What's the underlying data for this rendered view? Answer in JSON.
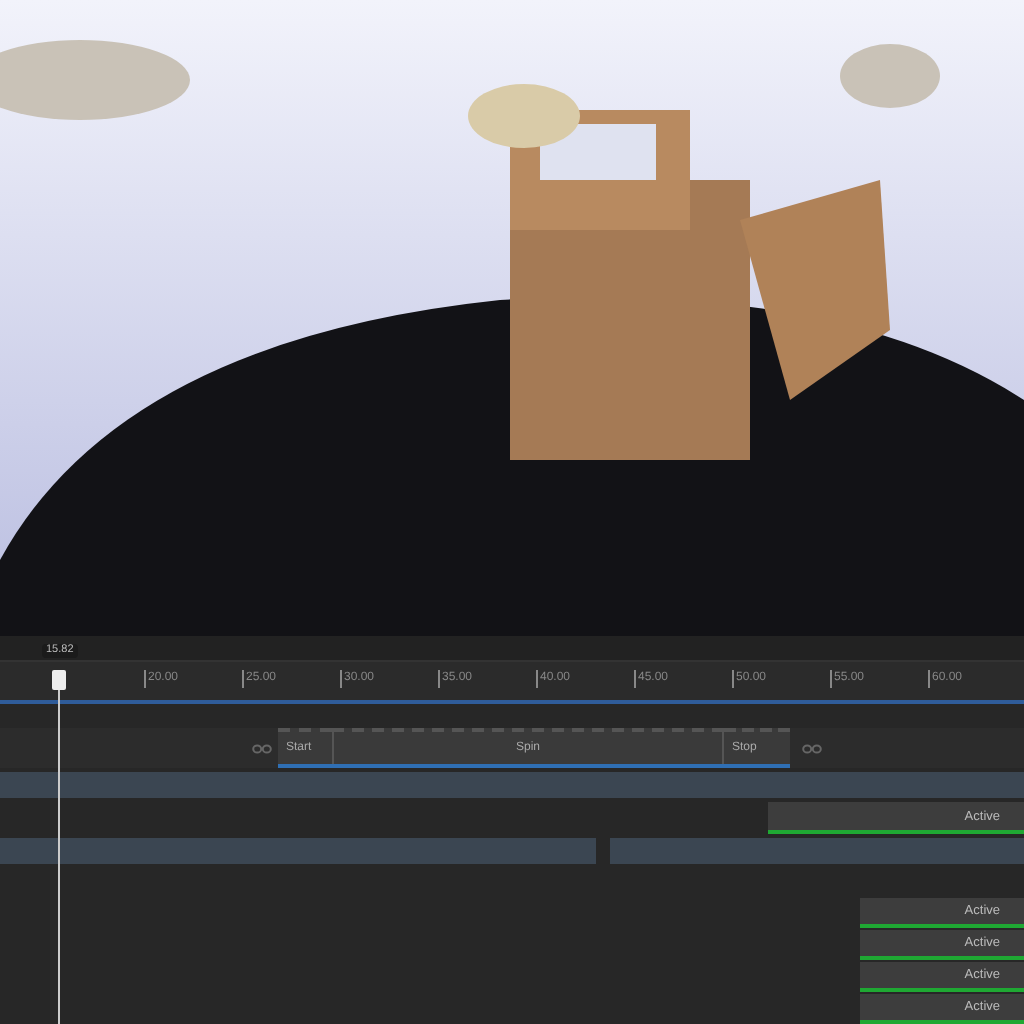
{
  "timeline": {
    "playhead": {
      "label": "15.82"
    },
    "ruler_ticks": [
      "20.00",
      "25.00",
      "30.00",
      "35.00",
      "40.00",
      "45.00",
      "50.00",
      "55.00",
      "60.00"
    ],
    "clips": [
      {
        "kind": "start",
        "label": "Start"
      },
      {
        "kind": "loop",
        "label": "Spin"
      },
      {
        "kind": "end",
        "label": "Stop"
      }
    ],
    "tracks": [
      {
        "kind": "band_full"
      },
      {
        "kind": "active_wide",
        "label": "Active"
      },
      {
        "kind": "band_split"
      },
      {
        "kind": "empty"
      },
      {
        "kind": "active",
        "label": "Active"
      },
      {
        "kind": "active",
        "label": "Active"
      },
      {
        "kind": "active",
        "label": "Active"
      },
      {
        "kind": "active",
        "label": "Active"
      }
    ]
  }
}
